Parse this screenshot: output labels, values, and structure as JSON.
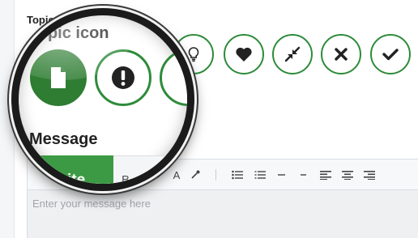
{
  "section": {
    "label": "Topic icon"
  },
  "lens": {
    "title": "Topic icon",
    "message_label": "Message",
    "write_tab": "Write",
    "partial_toolbar": "B"
  },
  "topic_icons": [
    {
      "name": "document",
      "icon": "file-icon",
      "selected": true
    },
    {
      "name": "exclamation",
      "icon": "exclamation-icon",
      "selected": false
    },
    {
      "name": "lightbulb",
      "icon": "lightbulb-icon",
      "selected": false
    },
    {
      "name": "heart",
      "icon": "heart-icon",
      "selected": false
    },
    {
      "name": "compress",
      "icon": "compress-icon",
      "selected": false
    },
    {
      "name": "times",
      "icon": "times-icon",
      "selected": false
    },
    {
      "name": "check",
      "icon": "check-icon",
      "selected": false
    }
  ],
  "editor": {
    "toolbar_font_label": "A",
    "placeholder": "Enter your message here"
  },
  "colors": {
    "accent": "#2e8b3a",
    "active_tab": "#3d9a44"
  }
}
